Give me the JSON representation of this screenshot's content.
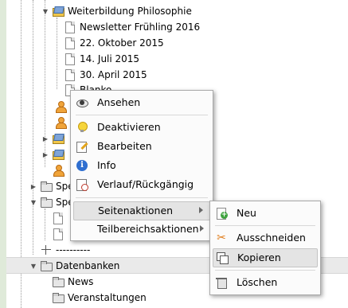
{
  "tree": {
    "items": [
      {
        "label": "Weiterbildung Philosophie"
      },
      {
        "label": "Newsletter Frühling 2016"
      },
      {
        "label": "22. Oktober 2015"
      },
      {
        "label": "14. Juli 2015"
      },
      {
        "label": "30. April 2015"
      },
      {
        "label": "Blanko"
      },
      {
        "label": "Spe"
      },
      {
        "label": "Spe"
      },
      {
        "label": "----------"
      },
      {
        "label": "Datenbanken"
      },
      {
        "label": "News"
      },
      {
        "label": "Veranstaltungen"
      }
    ]
  },
  "context_menu": {
    "items": [
      {
        "label": "Ansehen",
        "icon": "eye-icon"
      },
      {
        "label": "Deaktivieren",
        "icon": "bulb-icon"
      },
      {
        "label": "Bearbeiten",
        "icon": "edit-icon"
      },
      {
        "label": "Info",
        "icon": "info-icon"
      },
      {
        "label": "Verlauf/Rückgängig",
        "icon": "history-icon"
      },
      {
        "label": "Seitenaktionen",
        "icon": "chevron-right-icon"
      },
      {
        "label": "Teilbereichsaktionen",
        "icon": "chevron-right-icon"
      }
    ]
  },
  "submenu": {
    "items": [
      {
        "label": "Neu",
        "icon": "new-page-icon"
      },
      {
        "label": "Ausschneiden",
        "icon": "scissors-icon"
      },
      {
        "label": "Kopieren",
        "icon": "copy-icon"
      },
      {
        "label": "Löschen",
        "icon": "trash-icon"
      }
    ]
  }
}
